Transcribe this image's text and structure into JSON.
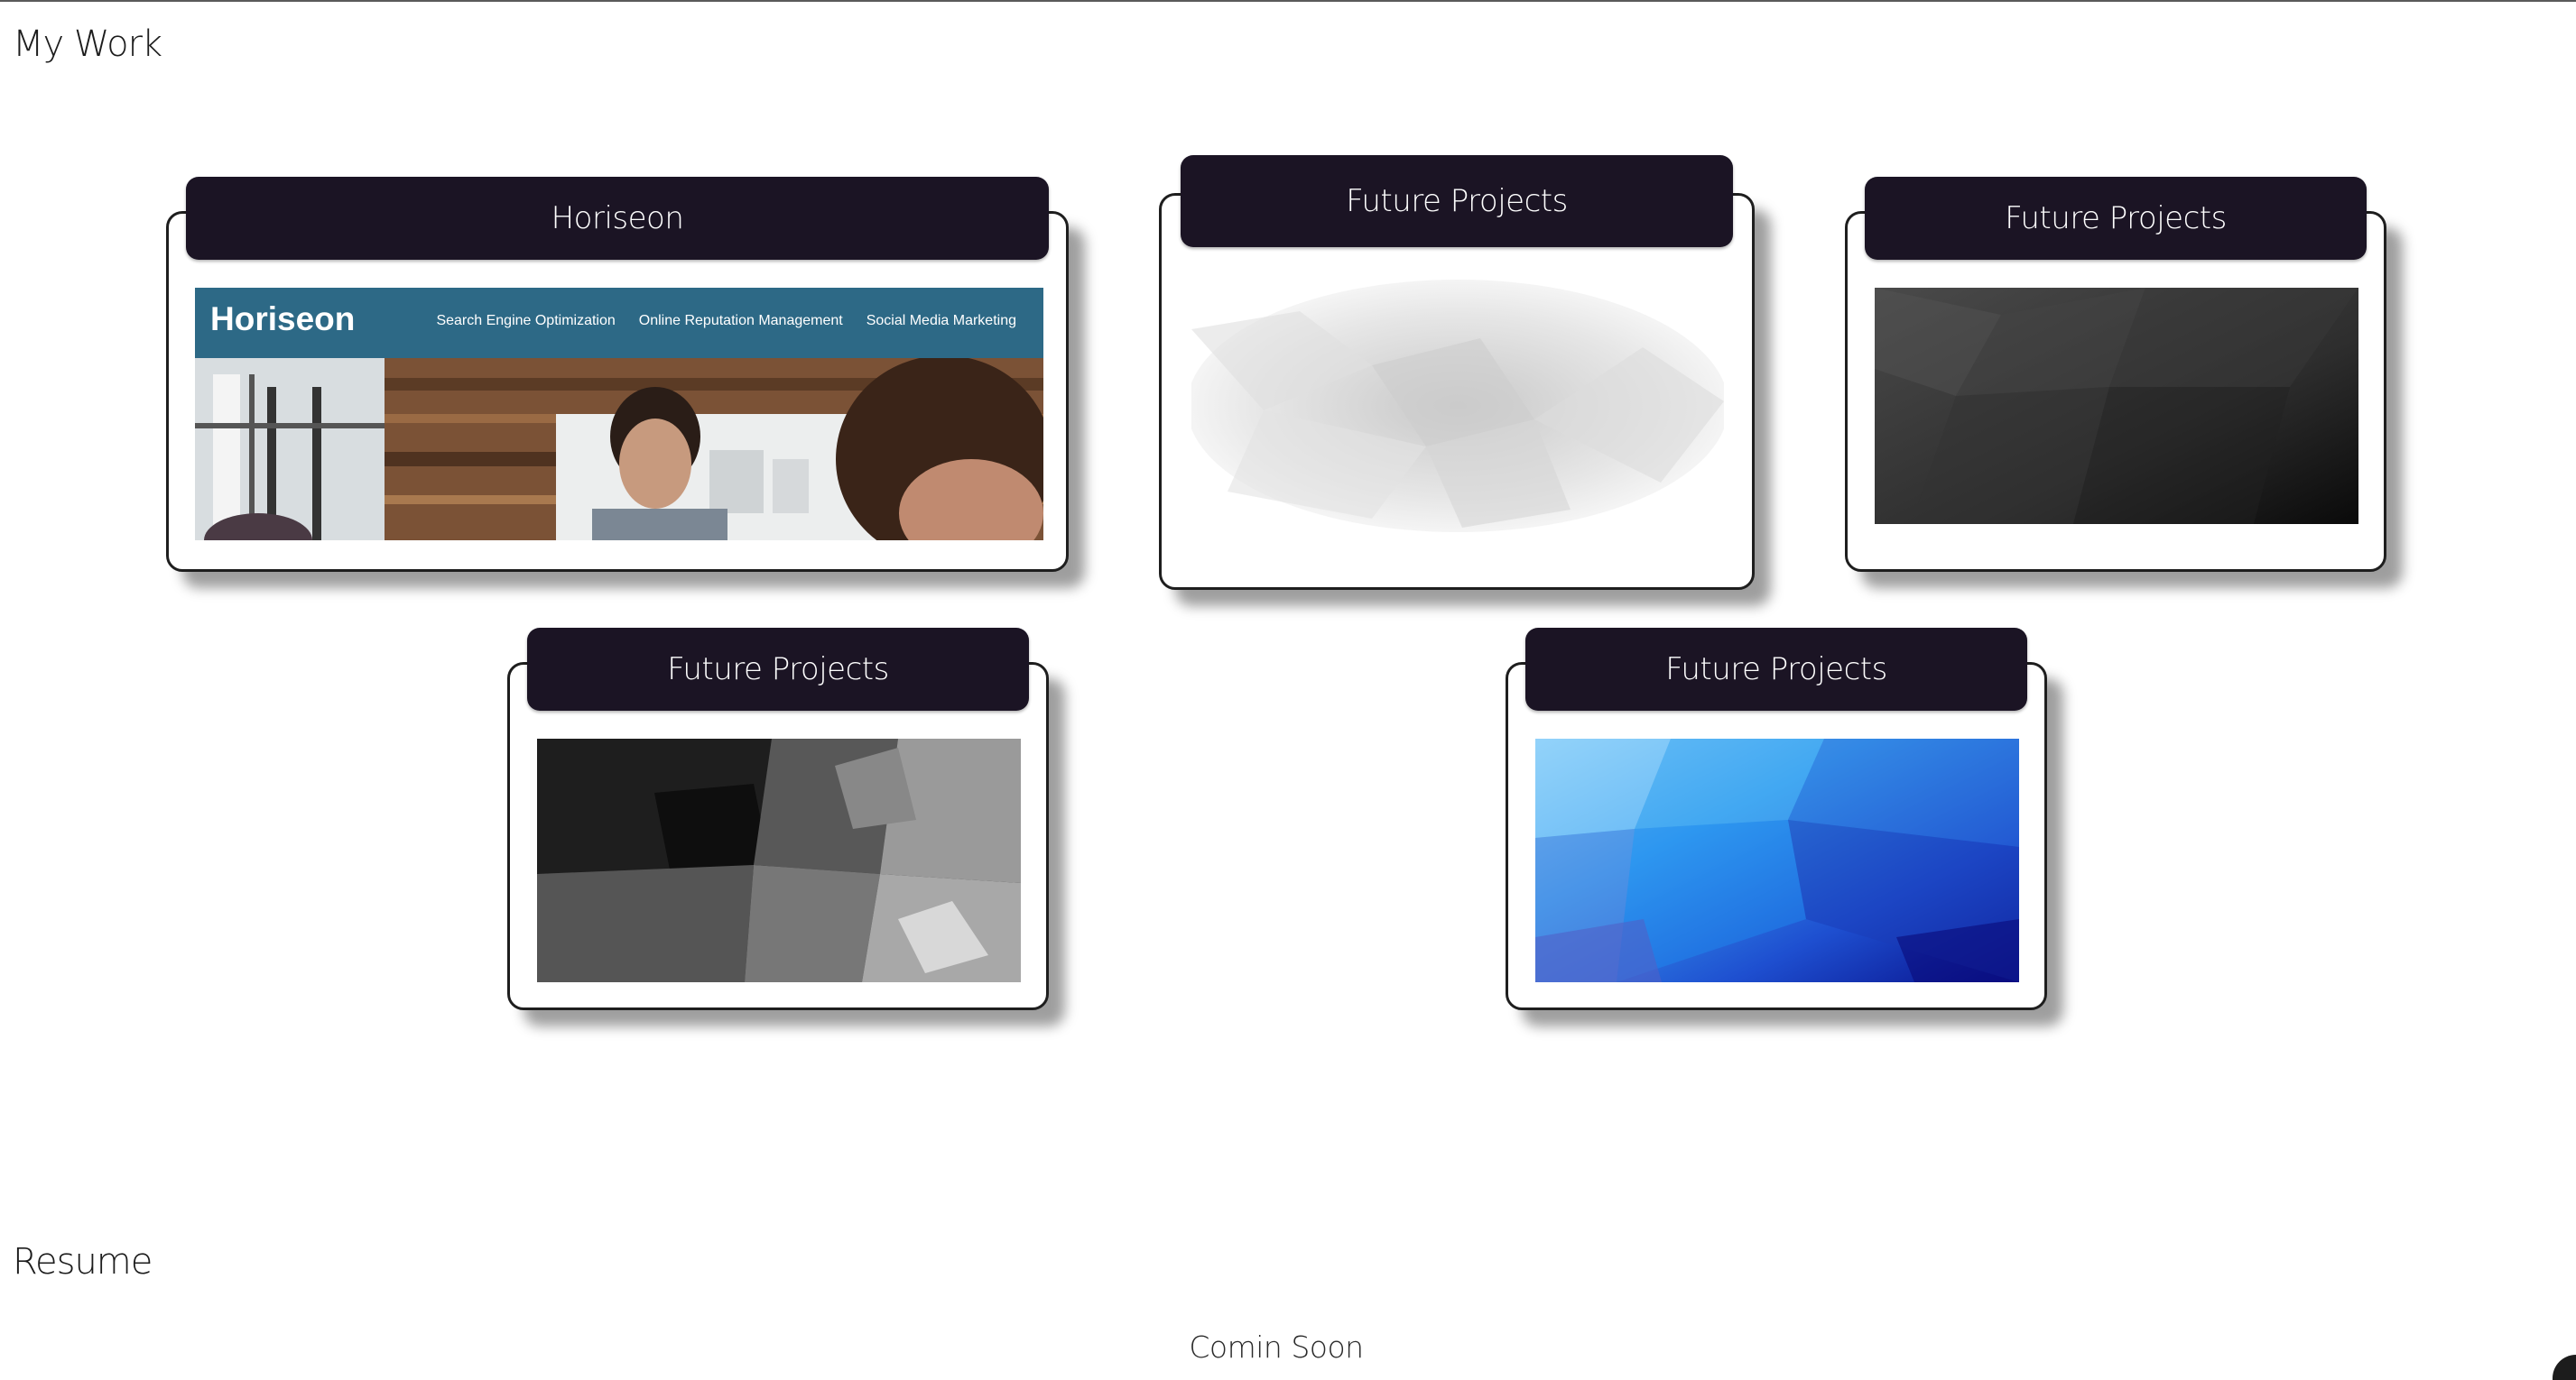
{
  "sections": {
    "work_title": "My Work",
    "resume_title": "Resume",
    "resume_text": "Comin Soon"
  },
  "projects": [
    {
      "title": "Horiseon",
      "thumbnail": {
        "brand": "Horiseon",
        "nav": [
          "Search Engine Optimization",
          "Online Reputation Management",
          "Social Media Marketing"
        ]
      }
    },
    {
      "title": "Future Projects",
      "thumbnail_theme": "light-gray-lowpoly"
    },
    {
      "title": "Future Projects",
      "thumbnail_theme": "dark-gray-lowpoly"
    },
    {
      "title": "Future Projects",
      "thumbnail_theme": "black-white-lowpoly"
    },
    {
      "title": "Future Projects",
      "thumbnail_theme": "blue-lowpoly"
    }
  ],
  "colors": {
    "tab_background": "#1b1424",
    "horiseon_header": "#2d6986"
  }
}
